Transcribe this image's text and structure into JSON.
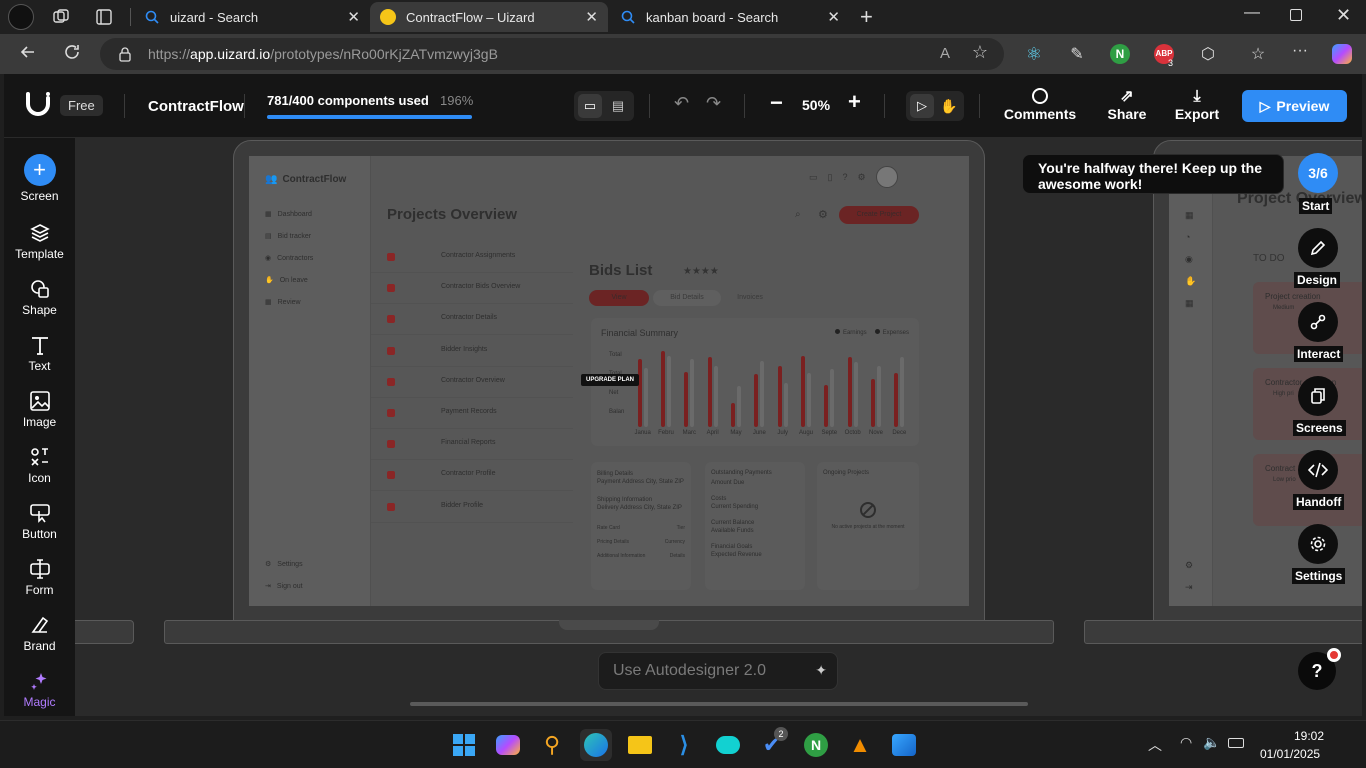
{
  "browser": {
    "tabs": [
      {
        "title": "uizard - Search",
        "active": false
      },
      {
        "title": "ContractFlow – Uizard",
        "active": true
      },
      {
        "title": "kanban board - Search",
        "active": false
      }
    ],
    "url_prefix": "https://",
    "url_host": "app.uizard.io",
    "url_path": "/prototypes/nRo00rKjZATvmzwyj3gB",
    "extension_badge": "3",
    "extension_abp": "ABP"
  },
  "topbar": {
    "plan_badge": "Free",
    "project_name": "ContractFlow",
    "components_used": "781/400 components used",
    "usage_percent": "196%",
    "usage_fraction": 1.0,
    "zoom": "50%",
    "comments_label": "Comments",
    "share_label": "Share",
    "export_label": "Export",
    "preview_label": "Preview"
  },
  "sidebar": {
    "items": [
      {
        "label": "Screen",
        "icon": "plus-icon"
      },
      {
        "label": "Template",
        "icon": "layers-icon"
      },
      {
        "label": "Shape",
        "icon": "shape-icon"
      },
      {
        "label": "Text",
        "icon": "text-icon"
      },
      {
        "label": "Image",
        "icon": "image-icon"
      },
      {
        "label": "Icon",
        "icon": "icon-icon"
      },
      {
        "label": "Button",
        "icon": "button-icon"
      },
      {
        "label": "Form",
        "icon": "form-icon"
      },
      {
        "label": "Brand",
        "icon": "brand-icon"
      },
      {
        "label": "Magic",
        "icon": "magic-icon"
      }
    ]
  },
  "mockup": {
    "app_name": "ContractFlow",
    "nav": [
      "Dashboard",
      "Bid tracker",
      "Contractors",
      "On leave",
      "Review"
    ],
    "nav_bottom": [
      "Settings",
      "Sign out"
    ],
    "page_title": "Projects Overview",
    "create_button": "Create Project",
    "list_items": [
      "Contractor Assignments",
      "Contractor Bids Overview",
      "Contractor Details",
      "Bidder Insights",
      "Contractor Overview",
      "Payment Records",
      "Financial Reports",
      "Contractor Profile",
      "Bidder Profile"
    ],
    "bids_title": "Bids List",
    "stars": "★★★★",
    "bid_tabs": [
      "View",
      "Bid Details",
      "Invoices"
    ],
    "upgrade_badge": "UPGRADE PLAN",
    "chart_title": "Financial Summary",
    "legend": [
      "Earnings",
      "Expenses"
    ],
    "chart_y_labels": [
      "Total",
      "Total",
      "",
      "Net",
      "Balan"
    ],
    "billing": {
      "title": "Billing Details",
      "address": "Payment Address City, State ZIP",
      "shipping_title": "Shipping Information",
      "shipping": "Delivery Address City, State ZIP",
      "rows": [
        [
          "Rate Card",
          "Tier"
        ],
        [
          "Pricing Details",
          "Currency"
        ],
        [
          "Additional Information",
          "Details"
        ]
      ]
    },
    "outstanding": {
      "title": "Outstanding Payments",
      "lines": [
        "Amount Due",
        "Costs",
        "Current Spending",
        "Current Balance",
        "Available Funds",
        "Financial Goals",
        "Expected Revenue"
      ]
    },
    "ongoing": {
      "title": "Ongoing Projects",
      "empty": "No active projects at the moment"
    }
  },
  "chart_data": {
    "type": "bar",
    "title": "Financial Summary",
    "categories": [
      "Janua",
      "Febru",
      "Marc",
      "April",
      "May",
      "June",
      "July",
      "Augu",
      "Septe",
      "Octob",
      "Nove",
      "Dece"
    ],
    "series": [
      {
        "name": "Earnings",
        "values": [
          80,
          90,
          65,
          82,
          28,
          62,
          72,
          84,
          50,
          82,
          57,
          64
        ]
      },
      {
        "name": "Expenses",
        "values": [
          70,
          84,
          80,
          72,
          48,
          78,
          52,
          64,
          68,
          76,
          72,
          82
        ]
      }
    ],
    "ylim": [
      0,
      100
    ]
  },
  "right_mockup": {
    "title": "Project Overview",
    "column": "TO DO",
    "cards": [
      {
        "title": "Project creation",
        "tag": "Medium"
      },
      {
        "title": "Contractor selection",
        "tag": "High pri"
      },
      {
        "title": "Contract",
        "tag": "Low prio"
      }
    ]
  },
  "tutorial": {
    "message": "You're halfway there! Keep up the awesome work!",
    "progress": "3/6",
    "steps": [
      "Start",
      "Design",
      "Interact",
      "Screens",
      "Handoff",
      "Settings"
    ]
  },
  "autodesigner_placeholder": "Use Autodesigner 2.0",
  "help_label": "?",
  "taskbar": {
    "time": "19:02",
    "date": "01/01/2025",
    "badge": "2"
  },
  "colors": {
    "accent": "#2f8cf5",
    "brand_red": "#b83232",
    "panel": "#151515"
  }
}
